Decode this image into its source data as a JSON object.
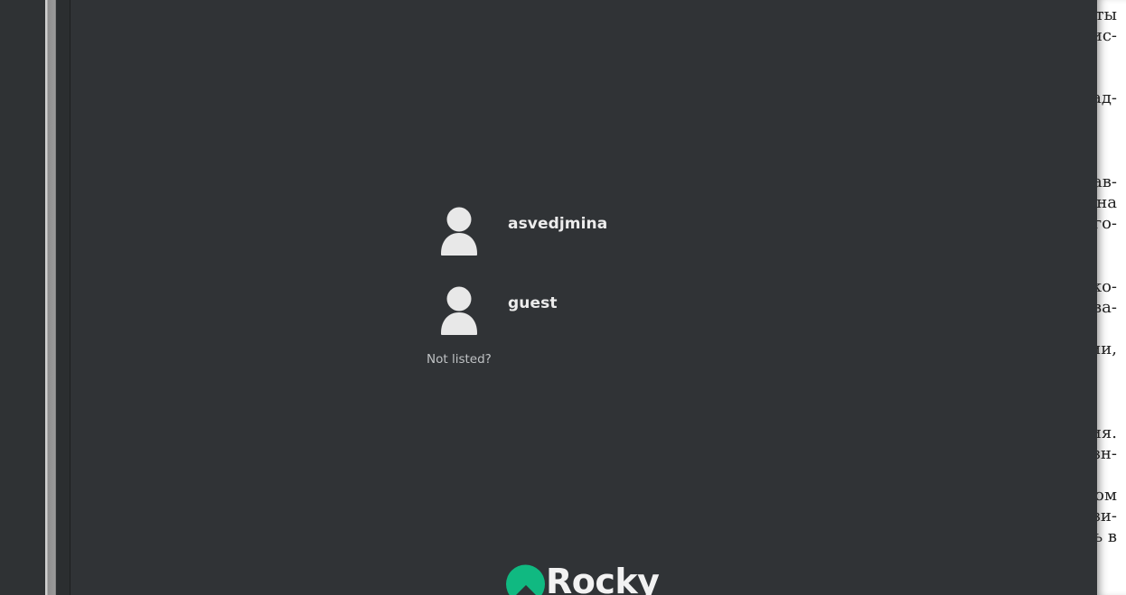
{
  "greeter": {
    "users": [
      {
        "name": "asvedjmina",
        "avatar_icon": "user-silhouette-icon"
      },
      {
        "name": "guest",
        "avatar_icon": "user-silhouette-icon"
      }
    ],
    "not_listed_label": "Not listed?",
    "logo_text": "Rocky",
    "logo_color": "#10b981",
    "background_color": "#303336"
  },
  "document_fragments": [
    "ты",
    "ис-",
    "ад-",
    "ав-",
    "на",
    "го-",
    "ко-",
    "ва-",
    "ии,",
    "ия.",
    "зн-",
    "ом",
    "зи-",
    "ь в"
  ]
}
